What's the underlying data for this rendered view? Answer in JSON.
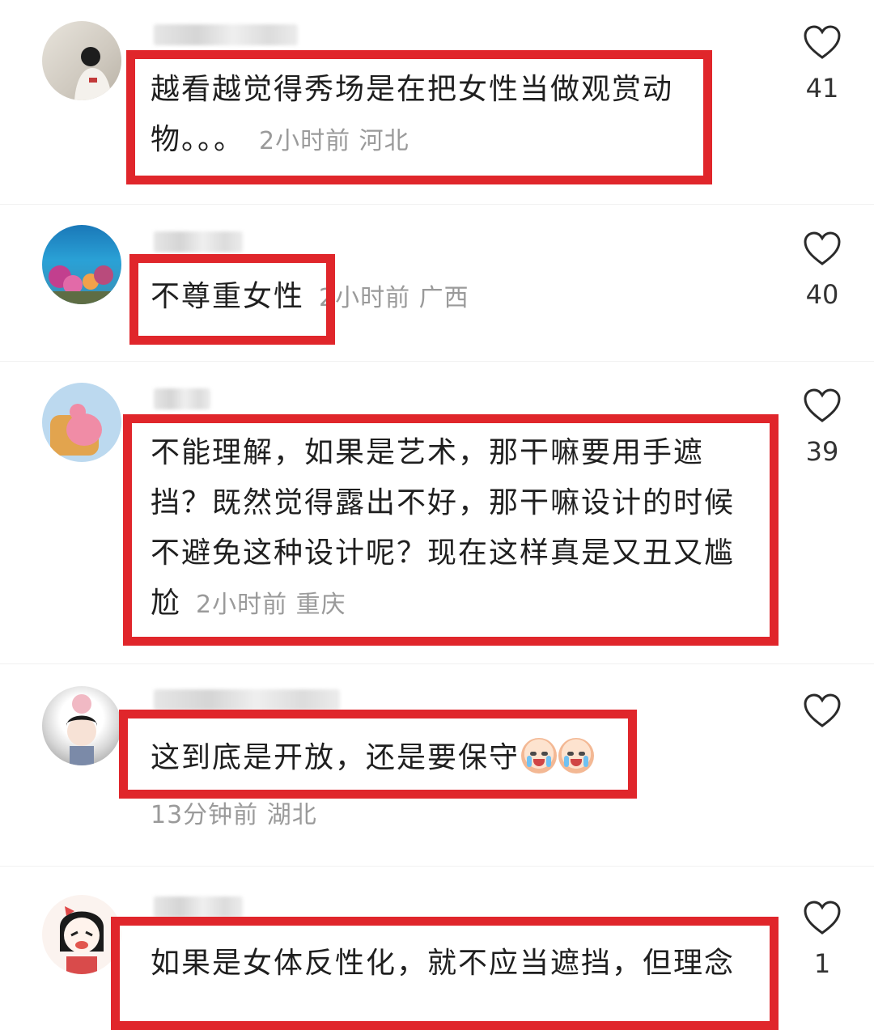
{
  "comments": [
    {
      "text": "越看越觉得秀场是在把女性当做观赏动\n物。。。",
      "meta": "2小时前 河北",
      "likes": "41"
    },
    {
      "text": "不尊重女性",
      "meta": "2小时前 广西",
      "likes": "40"
    },
    {
      "text": "不能理解，如果是艺术，那干嘛要用手遮\n挡？既然觉得露出不好，那干嘛设计的时候\n不避免这种设计呢？现在这样真是又丑又尴\n尬",
      "meta": "2小时前 重庆",
      "likes": "39"
    },
    {
      "text": "这到底是开放，还是要保守",
      "meta": "13分钟前 湖北",
      "likes": ""
    },
    {
      "text": "如果是女体反性化，就不应当遮挡，但理念",
      "meta": "",
      "likes": "1"
    }
  ],
  "icons": {
    "like": "heart-outline-icon",
    "emoji": "crying-face-emoji-icon"
  },
  "colors": {
    "highlight_box": "#e0262b",
    "meta_text": "#9a9a9a"
  }
}
